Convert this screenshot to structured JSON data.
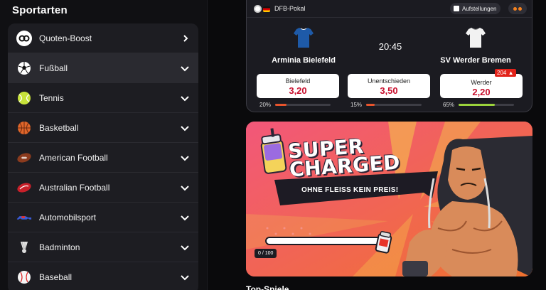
{
  "sidebar": {
    "title": "Sportarten",
    "items": [
      {
        "label": "Quoten-Boost",
        "icon": "boost-icon",
        "chevron": "right"
      },
      {
        "label": "Fußball",
        "icon": "soccer-ball-icon",
        "chevron": "down"
      },
      {
        "label": "Tennis",
        "icon": "tennis-ball-icon",
        "chevron": "down"
      },
      {
        "label": "Basketball",
        "icon": "basketball-icon",
        "chevron": "down"
      },
      {
        "label": "American Football",
        "icon": "american-football-icon",
        "chevron": "down"
      },
      {
        "label": "Australian Football",
        "icon": "australian-football-icon",
        "chevron": "down"
      },
      {
        "label": "Automobilsport",
        "icon": "race-car-icon",
        "chevron": "down"
      },
      {
        "label": "Badminton",
        "icon": "shuttlecock-icon",
        "chevron": "down"
      },
      {
        "label": "Baseball",
        "icon": "baseball-icon",
        "chevron": "down"
      }
    ]
  },
  "match": {
    "league": "DFB-Pokal",
    "lineups_label": "Aufstellungen",
    "home_team": "Arminia Bielefeld",
    "away_team": "SV Werder Bremen",
    "kickoff": "20:45",
    "odds": [
      {
        "label": "Bielefeld",
        "value": "3,20",
        "percent": "20%",
        "fill": 0.2,
        "color": "#e8542c"
      },
      {
        "label": "Unentschieden",
        "value": "3,50",
        "percent": "15%",
        "fill": 0.15,
        "color": "#e8542c"
      },
      {
        "label": "Werder",
        "value": "2,20",
        "percent": "65%",
        "fill": 0.65,
        "color": "#9bd33c"
      }
    ],
    "bet_count_badge": "204"
  },
  "promo": {
    "title_line1": "SUPER",
    "title_line2": "CHARGED",
    "subtitle": "OHNE FLEISS KEIN PREIS!",
    "progress_label": "0 / 100",
    "progress": 0
  },
  "bottom_heading": "Top-Spiele",
  "colors": {
    "accent_red": "#c8102e",
    "badge_red": "#e2231a",
    "home_kit": "#1e5aa8",
    "away_kit": "#f2f2f2"
  }
}
